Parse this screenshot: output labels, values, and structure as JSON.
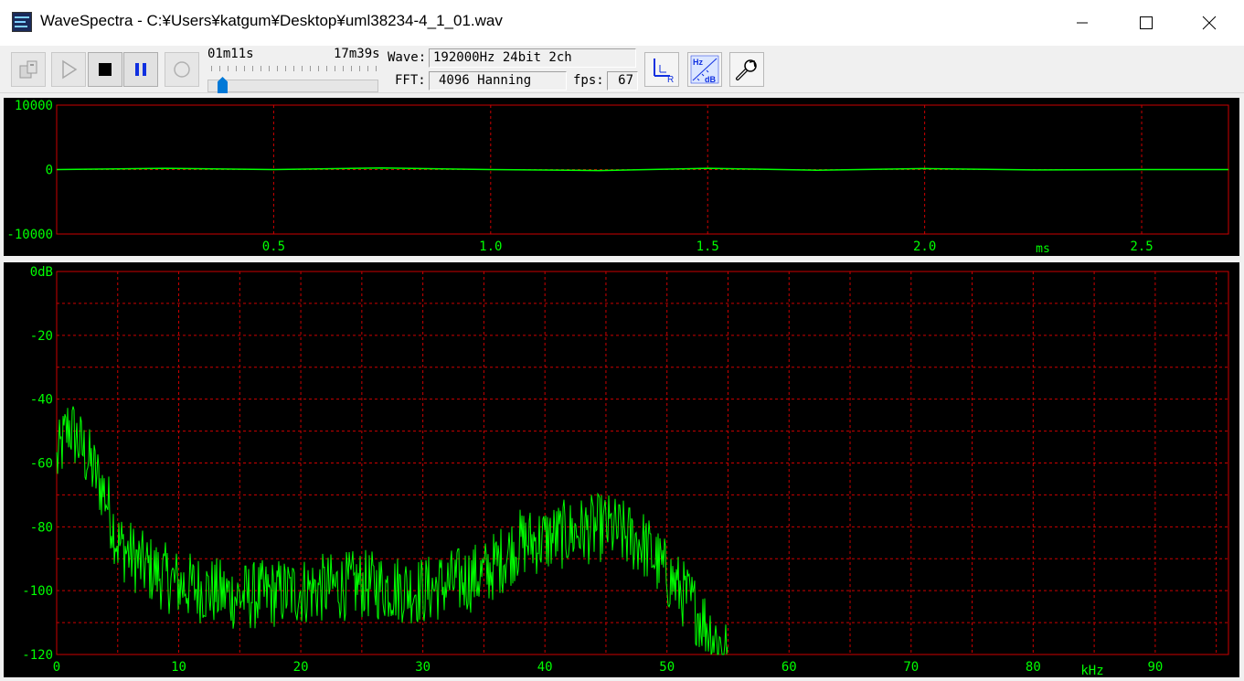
{
  "window": {
    "title": "WaveSpectra - C:¥Users¥katgum¥Desktop¥uml38234-4_1_01.wav",
    "controls": [
      "minimize-icon",
      "maximize-icon",
      "close-icon"
    ]
  },
  "toolbar": {
    "position_label": "01m11s",
    "duration_label": "17m39s",
    "position_fraction": 0.067,
    "wave_label": "Wave:",
    "wave_value": "192000Hz 24bit 2ch",
    "fft_label": "FFT:",
    "fft_value": "4096 Hanning",
    "fps_label": "fps:",
    "fps_value": "67",
    "lr_button_icon": "lr-channel-icon",
    "hzdb_button_icon": "hz-db-scale-icon",
    "settings_button_icon": "wrench-icon",
    "hz_text": "Hz",
    "db_text": "dB"
  },
  "colors": {
    "trace": "#00ff00",
    "grid": "#cc0000",
    "frame": "#cc0000",
    "label": "#00ff00",
    "background": "#000000"
  },
  "waveform": {
    "y_ticks": [
      "10000",
      "0",
      "-10000"
    ],
    "x_ticks": [
      "0.5",
      "1.0",
      "1.5",
      "2.0",
      "2.5"
    ],
    "x_unit": "ms",
    "x_range_ms": [
      0,
      2.7
    ],
    "y_range": [
      -10000,
      10000
    ]
  },
  "spectrum": {
    "y_ticks": [
      "0dB",
      "-20",
      "-40",
      "-60",
      "-80",
      "-100",
      "-120"
    ],
    "x_ticks": [
      "0",
      "10",
      "20",
      "30",
      "40",
      "50",
      "60",
      "70",
      "80",
      "90"
    ],
    "x_unit": "kHz",
    "x_range_khz": [
      0,
      96
    ],
    "y_range_db": [
      -120,
      0
    ]
  },
  "chart_data": [
    {
      "type": "line",
      "x_unit": "ms",
      "x": [
        0,
        0.25,
        0.5,
        0.75,
        1.0,
        1.25,
        1.5,
        1.75,
        2.0,
        2.25,
        2.5,
        2.7
      ],
      "values": [
        0,
        200,
        0,
        250,
        0,
        -150,
        200,
        -100,
        150,
        -50,
        0,
        0
      ],
      "ylim": [
        -10000,
        10000
      ],
      "grid": true
    },
    {
      "type": "line",
      "x_unit": "kHz",
      "y_unit": "dB",
      "x": [
        0,
        1,
        2,
        3,
        4,
        5,
        7,
        10,
        15,
        20,
        25,
        30,
        35,
        38,
        40,
        42,
        45,
        48,
        50,
        52,
        54,
        55
      ],
      "values": [
        -60,
        -48,
        -55,
        -62,
        -70,
        -85,
        -92,
        -98,
        -102,
        -100,
        -98,
        -100,
        -95,
        -85,
        -84,
        -82,
        -80,
        -85,
        -95,
        -104,
        -115,
        -120
      ],
      "ylim": [
        -120,
        0
      ],
      "xlim": [
        0,
        96
      ],
      "grid": true
    }
  ]
}
